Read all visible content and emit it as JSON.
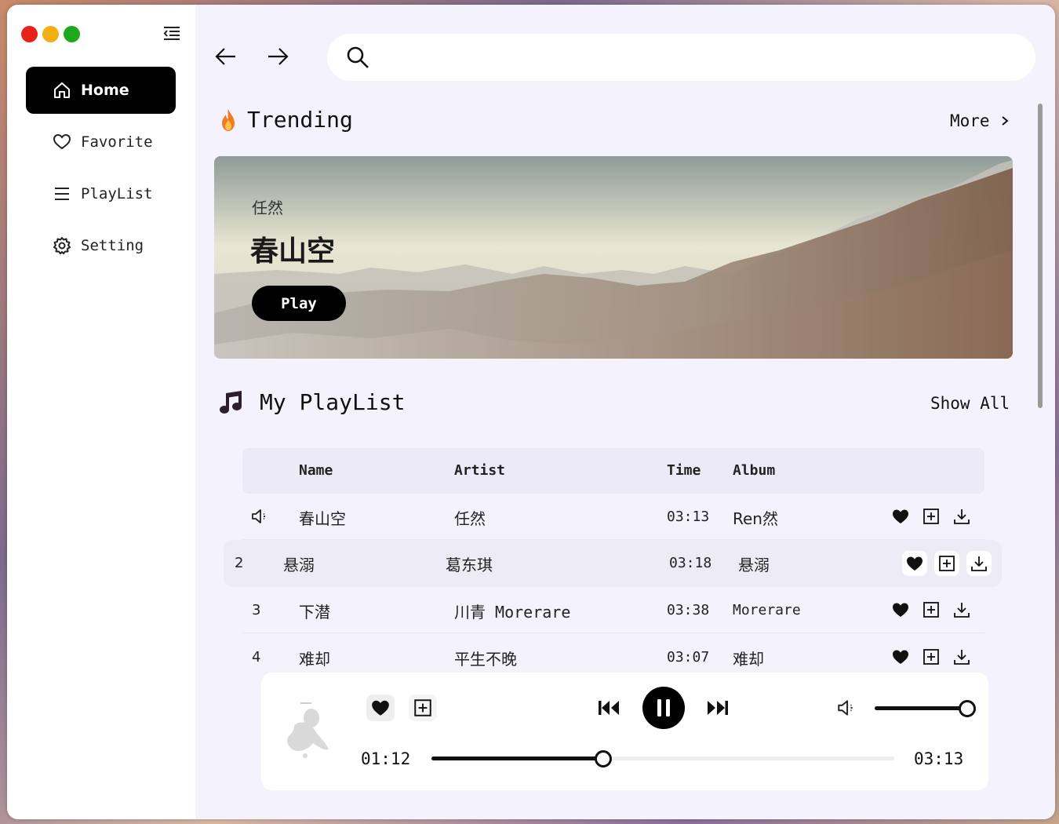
{
  "window": {
    "traffic_lights": [
      "#e8211b",
      "#f3ae13",
      "#1ea81b"
    ]
  },
  "sidebar": {
    "collapse_icon": "menu-collapse-icon",
    "items": [
      {
        "label": "Home",
        "icon": "home-icon",
        "active": true
      },
      {
        "label": "Favorite",
        "icon": "heart-outline-icon"
      },
      {
        "label": "PlayList",
        "icon": "list-icon"
      },
      {
        "label": "Setting",
        "icon": "gear-icon"
      }
    ]
  },
  "topbar": {
    "search_placeholder": ""
  },
  "trending": {
    "title": "Trending",
    "more_label": "More",
    "banner": {
      "artist": "任然",
      "song": "春山空",
      "play_label": "Play"
    }
  },
  "playlist": {
    "title": "My PlayList",
    "show_all_label": "Show All",
    "columns": {
      "name": "Name",
      "artist": "Artist",
      "time": "Time",
      "album": "Album"
    },
    "rows": [
      {
        "index": "",
        "playing": true,
        "name": "春山空",
        "artist": "任然",
        "time": "03:13",
        "album": "Ren然"
      },
      {
        "index": "2",
        "name": "悬溺",
        "artist": "葛东琪",
        "time": "03:18",
        "album": "悬溺",
        "highlighted": true
      },
      {
        "index": "3",
        "name": "下潜",
        "artist": "川青 Morerare",
        "time": "03:38",
        "album": "Morerare"
      },
      {
        "index": "4",
        "name": "难却",
        "artist": "平生不晚",
        "time": "03:07",
        "album": "难却"
      }
    ]
  },
  "player": {
    "elapsed": "01:12",
    "duration": "03:13",
    "progress_fraction": 0.372,
    "volume_fraction": 1.0,
    "state": "playing"
  },
  "colors": {
    "accent": "#000000",
    "background": "#f4f3fd",
    "flame": "#f47a1f"
  }
}
